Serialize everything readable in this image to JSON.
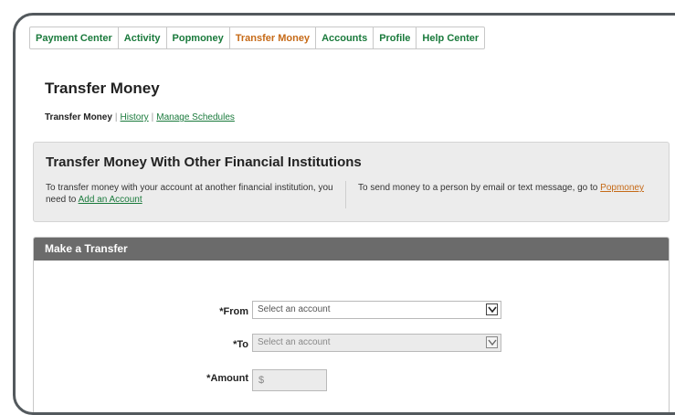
{
  "nav": {
    "items": [
      {
        "label": "Payment Center"
      },
      {
        "label": "Activity"
      },
      {
        "label": "Popmoney"
      },
      {
        "label": "Transfer Money"
      },
      {
        "label": "Accounts"
      },
      {
        "label": "Profile"
      },
      {
        "label": "Help Center"
      }
    ],
    "active": "Transfer Money",
    "active_color": "#c66a17",
    "link_color": "#1a7a3c"
  },
  "page": {
    "title": "Transfer Money"
  },
  "subnav": {
    "current": "Transfer Money",
    "history": "History",
    "manage_schedules": "Manage Schedules"
  },
  "info": {
    "title": "Transfer Money With Other Financial Institutions",
    "left_text": "To transfer money with your account at another financial institution, you need to ",
    "left_link": "Add an Account",
    "right_text": "To send money to a person by email or text message, go to ",
    "right_link": "Popmoney"
  },
  "transfer": {
    "header": "Make a Transfer",
    "from_label": "*From",
    "from_value": "Select an account",
    "to_label": "*To",
    "to_value": "Select an account",
    "amount_label": "*Amount",
    "amount_placeholder": "$",
    "header_color": "#6b6b6b"
  },
  "icons": {
    "dropdown": "chevron-down-icon"
  }
}
